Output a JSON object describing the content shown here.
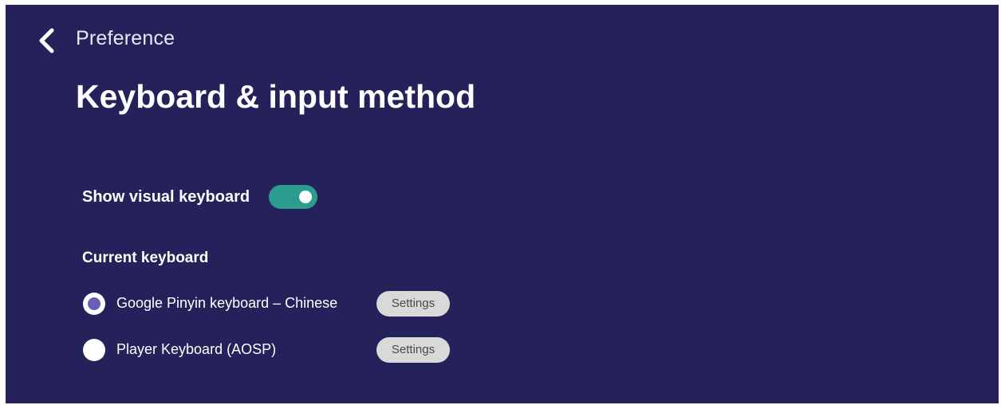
{
  "header": {
    "breadcrumb": "Preference",
    "title": "Keyboard & input method",
    "back_icon": "chevron-left-icon"
  },
  "visual_keyboard": {
    "label": "Show visual keyboard",
    "enabled": true
  },
  "current_keyboard": {
    "title": "Current keyboard",
    "options": [
      {
        "label": "Google Pinyin keyboard – Chinese",
        "selected": true,
        "settings_label": "Settings"
      },
      {
        "label": "Player Keyboard (AOSP)",
        "selected": false,
        "settings_label": "Settings"
      }
    ]
  },
  "colors": {
    "background": "#25215a",
    "toggle_on": "#2a9d8f",
    "radio_selected": "#6a5fb5",
    "settings_button": "#d9d9d9"
  }
}
